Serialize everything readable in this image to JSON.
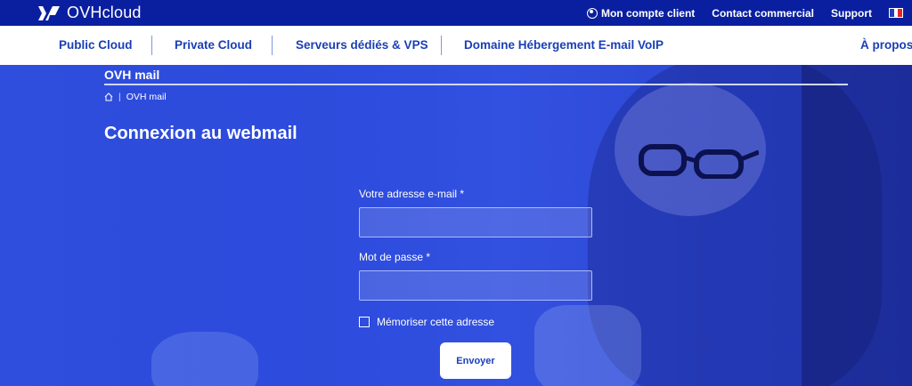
{
  "brand": {
    "logo_text": "OVHcloud"
  },
  "topbar": {
    "account_label": "Mon compte client",
    "contact_label": "Contact commercial",
    "support_label": "Support",
    "language_flag_icon": "french-flag-icon",
    "colors": {
      "background": "#0a1fa0"
    }
  },
  "nav": {
    "items": [
      {
        "label": "Public Cloud"
      },
      {
        "label": "Private Cloud"
      },
      {
        "label": "Serveurs dédiés & VPS"
      },
      {
        "label": "Domaine Hébergement E-mail VoIP"
      }
    ],
    "about_label": "À propos"
  },
  "page": {
    "title": "OVH mail",
    "breadcrumb": {
      "home_icon": "home-icon",
      "current": "OVH mail"
    },
    "heading": "Connexion au webmail"
  },
  "form": {
    "email_label": "Votre adresse e-mail *",
    "email_value": "",
    "password_label": "Mot de passe *",
    "password_value": "",
    "remember_label": "Mémoriser cette adresse",
    "remember_checked": false,
    "submit_label": "Envoyer"
  },
  "colors": {
    "accent": "#1a3fb6",
    "hero": "#2e4cdd"
  }
}
